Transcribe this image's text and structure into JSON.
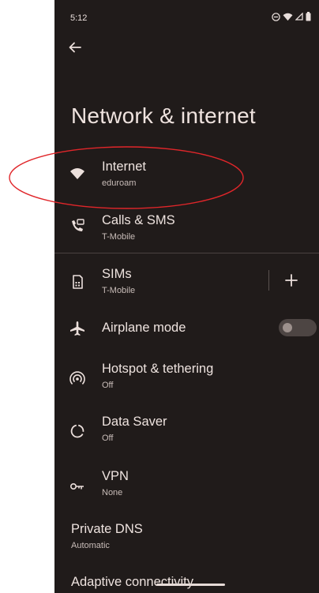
{
  "status_bar": {
    "time": "5:12"
  },
  "page": {
    "title": "Network & internet"
  },
  "items": [
    {
      "label": "Internet",
      "sub": "eduroam"
    },
    {
      "label": "Calls & SMS",
      "sub": "T-Mobile"
    },
    {
      "label": "SIMs",
      "sub": "T-Mobile"
    },
    {
      "label": "Airplane mode",
      "sub": ""
    },
    {
      "label": "Hotspot & tethering",
      "sub": "Off"
    },
    {
      "label": "Data Saver",
      "sub": "Off"
    },
    {
      "label": "VPN",
      "sub": "None"
    },
    {
      "label": "Private DNS",
      "sub": "Automatic"
    },
    {
      "label": "Adaptive connectivity",
      "sub": ""
    }
  ],
  "airplane_mode": {
    "on": false
  },
  "colors": {
    "background": "#201b1a",
    "text": "#ece0dc",
    "annotation": "#e0262a"
  },
  "icons": [
    "back-arrow-icon",
    "wifi-icon",
    "phone-sms-icon",
    "sim-card-icon",
    "add-icon",
    "airplane-icon",
    "hotspot-icon",
    "data-saver-icon",
    "vpn-key-icon",
    "do-not-disturb-icon",
    "signal-icon",
    "battery-icon"
  ]
}
